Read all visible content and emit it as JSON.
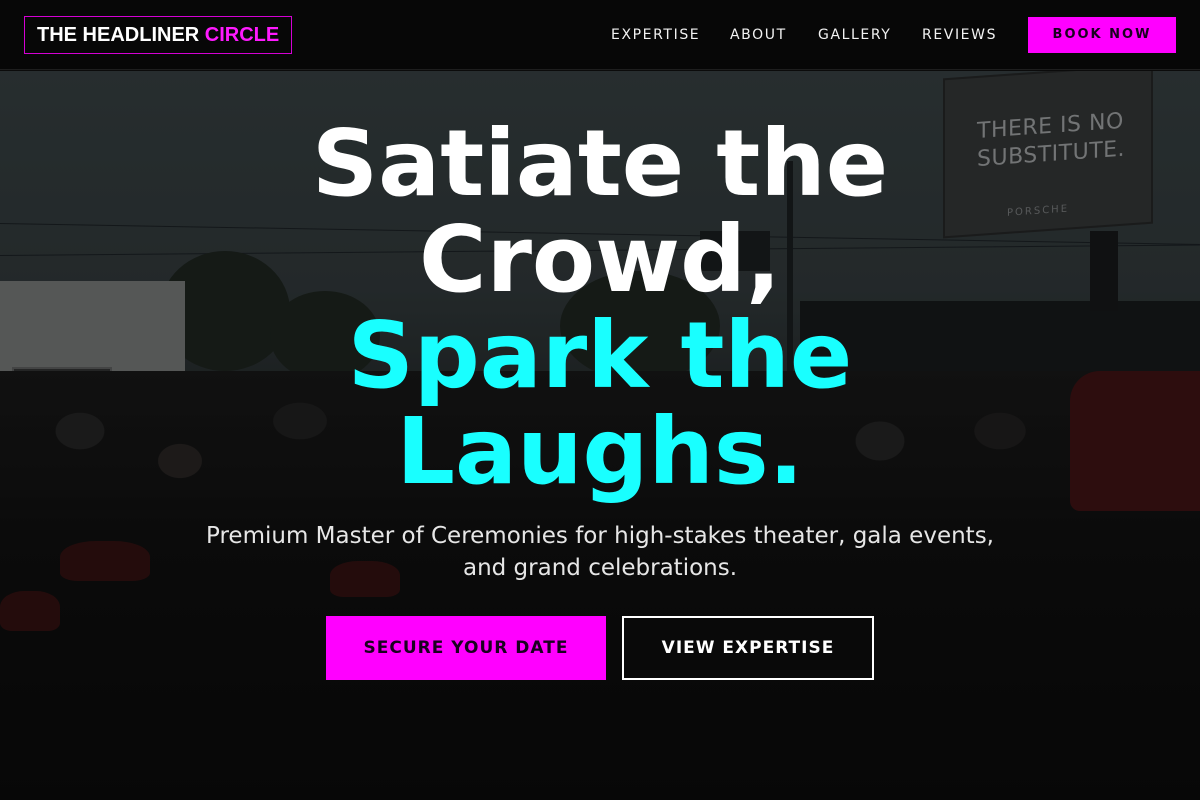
{
  "brand": {
    "logo_main": "THE HEADLINER ",
    "logo_accent": "CIRCLE"
  },
  "nav": {
    "links": [
      {
        "label": "EXPERTISE"
      },
      {
        "label": "ABOUT"
      },
      {
        "label": "GALLERY"
      },
      {
        "label": "REVIEWS"
      }
    ],
    "cta_label": "BOOK NOW"
  },
  "hero": {
    "headline_line1": "Satiate the",
    "headline_line2": "Crowd,",
    "headline_line3": "Spark the",
    "headline_line4": "Laughs.",
    "subtitle_line1": "Premium Master of Ceremonies for high-stakes theater, gala events,",
    "subtitle_line2": "and grand celebrations.",
    "primary_cta": "SECURE YOUR DATE",
    "secondary_cta": "VIEW EXPERTISE",
    "background_billboard_line1": "THERE IS NO",
    "background_billboard_line2": "SUBSTITUTE.",
    "background_billboard_brand": "PORSCHE"
  },
  "colors": {
    "accent_magenta": "#ff00ff",
    "accent_cyan": "#19ffff",
    "nav_background": "#070707",
    "text_primary": "#ffffff"
  }
}
